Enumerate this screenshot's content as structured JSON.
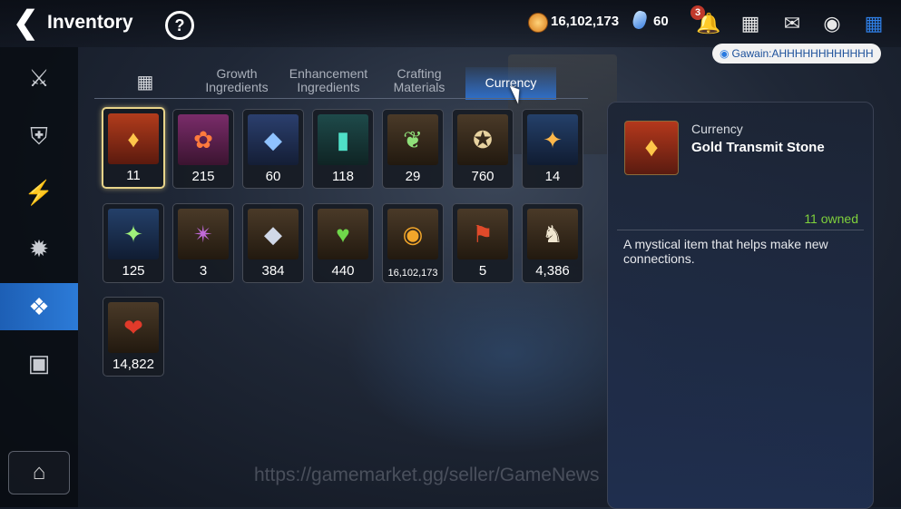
{
  "header": {
    "back_icon": "chevron-left-icon",
    "title": "Inventory",
    "help_label": "?",
    "gold": "16,102,173",
    "skystone": "60",
    "notification_count": "3"
  },
  "chat": {
    "sender": "Gawain",
    "message": "AHHHHHHHHHHHH",
    "separator": ":"
  },
  "sidebar": {
    "items": [
      {
        "name": "equipment",
        "icon": "sword-shield-icon"
      },
      {
        "name": "artifacts",
        "icon": "shield-icon"
      },
      {
        "name": "skill",
        "icon": "lightning-icon"
      },
      {
        "name": "monster",
        "icon": "monster-icon"
      },
      {
        "name": "materials",
        "icon": "materials-icon",
        "active": true
      },
      {
        "name": "chest",
        "icon": "chest-icon"
      }
    ],
    "bottom_icon": "storage-icon"
  },
  "tabs": [
    {
      "label": "",
      "icon": "grid-icon"
    },
    {
      "label": "Growth Ingredients"
    },
    {
      "label": "Enhancement Ingredients"
    },
    {
      "label": "Crafting Materials"
    },
    {
      "label": "Currency",
      "active": true
    }
  ],
  "items": [
    {
      "qty": "11",
      "name": "gold-transmit-stone",
      "selected": true
    },
    {
      "qty": "215",
      "name": "charm"
    },
    {
      "qty": "60",
      "name": "blue-crystal"
    },
    {
      "qty": "118",
      "name": "teal-crystal"
    },
    {
      "qty": "29",
      "name": "leaf"
    },
    {
      "qty": "760",
      "name": "compass-coin"
    },
    {
      "qty": "14",
      "name": "star-charm"
    },
    {
      "qty": "125",
      "name": "green-star-charm"
    },
    {
      "qty": "3",
      "name": "purple-badge"
    },
    {
      "qty": "384",
      "name": "silver-crystal"
    },
    {
      "qty": "440",
      "name": "green-heart"
    },
    {
      "qty": "16,102,173",
      "name": "gold-coin"
    },
    {
      "qty": "5",
      "name": "banner"
    },
    {
      "qty": "4,386",
      "name": "chess-knight"
    },
    {
      "qty": "14,822",
      "name": "red-mask"
    }
  ],
  "detail": {
    "category": "Currency",
    "name": "Gold Transmit Stone",
    "owned": "11 owned",
    "description": "A mystical item that helps make new connections."
  },
  "watermark": "https://gamemarket.gg/seller/GameNews"
}
